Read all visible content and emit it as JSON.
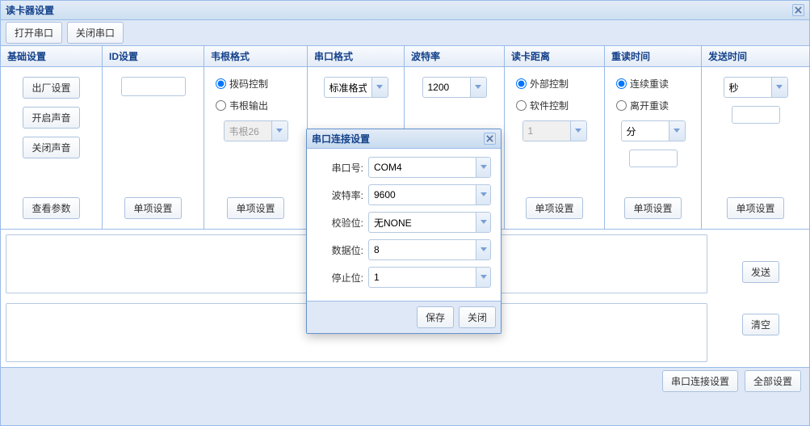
{
  "window": {
    "title": "读卡器设置"
  },
  "toolbar": {
    "open_port": "打开串口",
    "close_port": "关闭串口"
  },
  "cols": {
    "basic": {
      "header": "基础设置",
      "btn_factory": "出厂设置",
      "btn_sound_on": "开启声音",
      "btn_sound_off": "关闭声音",
      "btn_view": "查看参数"
    },
    "id": {
      "header": "ID设置",
      "value": "",
      "btn": "单项设置"
    },
    "wiegand": {
      "header": "韦根格式",
      "opt_dial": "拨码控制",
      "opt_out": "韦根输出",
      "combo_val": "韦根26",
      "btn": "单项设置"
    },
    "serial": {
      "header": "串口格式",
      "combo_val": "标准格式"
    },
    "baud": {
      "header": "波特率",
      "combo_val": "1200"
    },
    "dist": {
      "header": "读卡距离",
      "opt_ext": "外部控制",
      "opt_soft": "软件控制",
      "combo_val": "1",
      "btn": "单项设置"
    },
    "reread": {
      "header": "重读时间",
      "opt_cont": "连续重读",
      "opt_leave": "离开重读",
      "unit_val": "分",
      "num_val": "",
      "btn": "单项设置"
    },
    "send": {
      "header": "发送时间",
      "unit_val": "秒",
      "num_val": "",
      "btn": "单项设置"
    }
  },
  "bottom": {
    "btn_send": "发送",
    "btn_clear": "清空"
  },
  "footer": {
    "btn_serial": "串口连接设置",
    "btn_all": "全部设置"
  },
  "modal": {
    "title": "串口连接设置",
    "port_label": "串口号:",
    "port_val": "COM4",
    "baud_label": "波特率:",
    "baud_val": "9600",
    "parity_label": "校验位:",
    "parity_val": "无NONE",
    "data_label": "数据位:",
    "data_val": "8",
    "stop_label": "停止位:",
    "stop_val": "1",
    "btn_save": "保存",
    "btn_close": "关闭"
  }
}
